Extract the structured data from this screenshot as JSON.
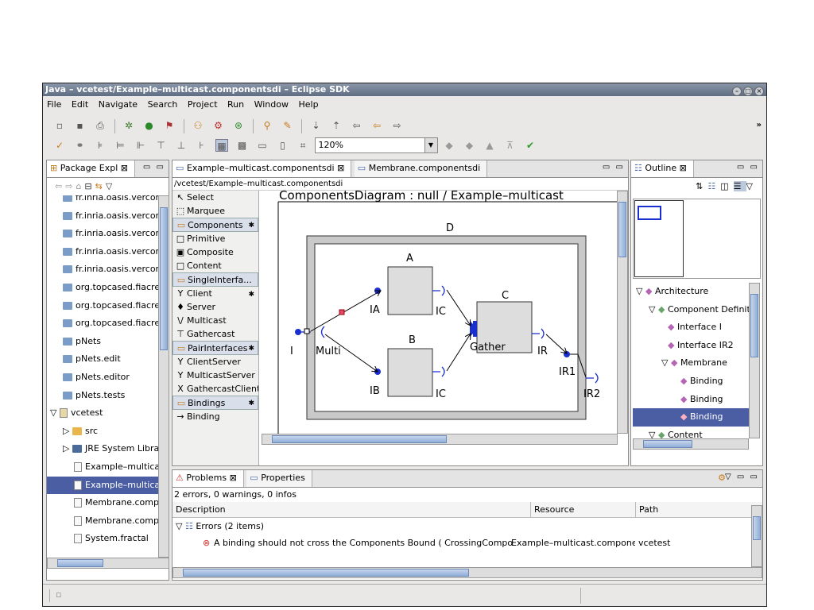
{
  "window": {
    "title": "Java – vcetest/Example–multicast.componentsdi – Eclipse SDK"
  },
  "menu": [
    "File",
    "Edit",
    "Navigate",
    "Search",
    "Project",
    "Run",
    "Window",
    "Help"
  ],
  "toolbar": {
    "zoom": "120%"
  },
  "package_explorer": {
    "tab": "Package Expl",
    "items": [
      {
        "label": "fr.inria.oasis.vercors.",
        "kind": "package"
      },
      {
        "label": "fr.inria.oasis.vercors.",
        "kind": "package"
      },
      {
        "label": "fr.inria.oasis.vercors.",
        "kind": "package"
      },
      {
        "label": "fr.inria.oasis.vercors.",
        "kind": "package"
      },
      {
        "label": "fr.inria.oasis.vercors.",
        "kind": "package"
      },
      {
        "label": "org.topcased.fiacre",
        "kind": "package"
      },
      {
        "label": "org.topcased.fiacre.l",
        "kind": "package"
      },
      {
        "label": "org.topcased.fiacre.u",
        "kind": "package"
      },
      {
        "label": "pNets",
        "kind": "package"
      },
      {
        "label": "pNets.edit",
        "kind": "package"
      },
      {
        "label": "pNets.editor",
        "kind": "package"
      },
      {
        "label": "pNets.tests",
        "kind": "package"
      },
      {
        "label": "vcetest",
        "kind": "project",
        "expanded": "▽"
      },
      {
        "label": "src",
        "kind": "folder",
        "expanded": "▷"
      },
      {
        "label": "JRE System Librar",
        "kind": "library",
        "expanded": "▷"
      },
      {
        "label": "Example–multicas",
        "kind": "file"
      },
      {
        "label": "Example–multicas",
        "kind": "file",
        "selected": true
      },
      {
        "label": "Membrane.compc",
        "kind": "file"
      },
      {
        "label": "Membrane.compc",
        "kind": "file"
      },
      {
        "label": "System.fractal",
        "kind": "file"
      }
    ]
  },
  "editor": {
    "tabs": [
      "Example–multicast.componentsdi ⊠",
      "Membrane.componentsdi"
    ],
    "path": "/vcetest/Example–multicast.componentsdi",
    "palette": [
      {
        "label": "Select",
        "type": "tool",
        "glyph": "↖"
      },
      {
        "label": "Marquee",
        "type": "tool",
        "glyph": "⬚"
      },
      {
        "label": "Components",
        "type": "drawer"
      },
      {
        "label": "Primitive",
        "type": "tool",
        "glyph": "□"
      },
      {
        "label": "Composite",
        "type": "tool",
        "glyph": "▣"
      },
      {
        "label": "Content",
        "type": "tool",
        "glyph": "□"
      },
      {
        "label": "SingleInterfa...",
        "type": "drawer"
      },
      {
        "label": "Client",
        "type": "tool",
        "glyph": "Y"
      },
      {
        "label": "Server",
        "type": "tool",
        "glyph": "♦"
      },
      {
        "label": "Multicast",
        "type": "tool",
        "glyph": "\\/"
      },
      {
        "label": "Gathercast",
        "type": "tool",
        "glyph": "⊤"
      },
      {
        "label": "PairInterfaces",
        "type": "drawer"
      },
      {
        "label": "ClientServer",
        "type": "tool",
        "glyph": "Y"
      },
      {
        "label": "MulticastServer",
        "type": "tool",
        "glyph": "Y"
      },
      {
        "label": "GathercastClient",
        "type": "tool",
        "glyph": "X"
      },
      {
        "label": "Bindings",
        "type": "drawer"
      },
      {
        "label": "Binding",
        "type": "tool",
        "glyph": "→"
      }
    ],
    "diagram": {
      "title": "ComponentsDiagram : null / Example–multicast",
      "composite": "D",
      "components": [
        "A",
        "B",
        "C"
      ],
      "labels": {
        "I": "I",
        "Multi": "Multi",
        "IA": "IA",
        "IB": "IB",
        "IC1": "IC",
        "IC2": "IC",
        "Gather": "Gather",
        "IR": "IR",
        "IR1": "IR1",
        "IR2": "IR2"
      }
    }
  },
  "outline": {
    "tab": "Outline",
    "tree": [
      {
        "label": "Architecture",
        "indent": 0,
        "toggle": "▽"
      },
      {
        "label": "Component Definiti",
        "indent": 1,
        "toggle": "▽"
      },
      {
        "label": "Interface I",
        "indent": 2,
        "toggle": ""
      },
      {
        "label": "Interface IR2",
        "indent": 2,
        "toggle": ""
      },
      {
        "label": "Membrane",
        "indent": 2,
        "toggle": "▽"
      },
      {
        "label": "Binding",
        "indent": 3,
        "toggle": ""
      },
      {
        "label": "Binding",
        "indent": 3,
        "toggle": ""
      },
      {
        "label": "Binding",
        "indent": 3,
        "toggle": "",
        "selected": true
      },
      {
        "label": "Content",
        "indent": 1,
        "toggle": "▽"
      }
    ]
  },
  "problems": {
    "tabs": [
      "Problems ⊠",
      "Properties"
    ],
    "summary": "2 errors, 0 warnings, 0 infos",
    "columns": [
      "Description",
      "Resource",
      "Path"
    ],
    "group": "Errors (2 items)",
    "rows": [
      {
        "description": "A binding should not cross the Components Bound ( CrossingComponentBc",
        "resource": "Example–multicast.components",
        "path": "vcetest"
      }
    ]
  },
  "colors": {
    "selection": "#4b5ea3",
    "error": "#d9322e",
    "diagram_blue": "#1a2fcf"
  }
}
